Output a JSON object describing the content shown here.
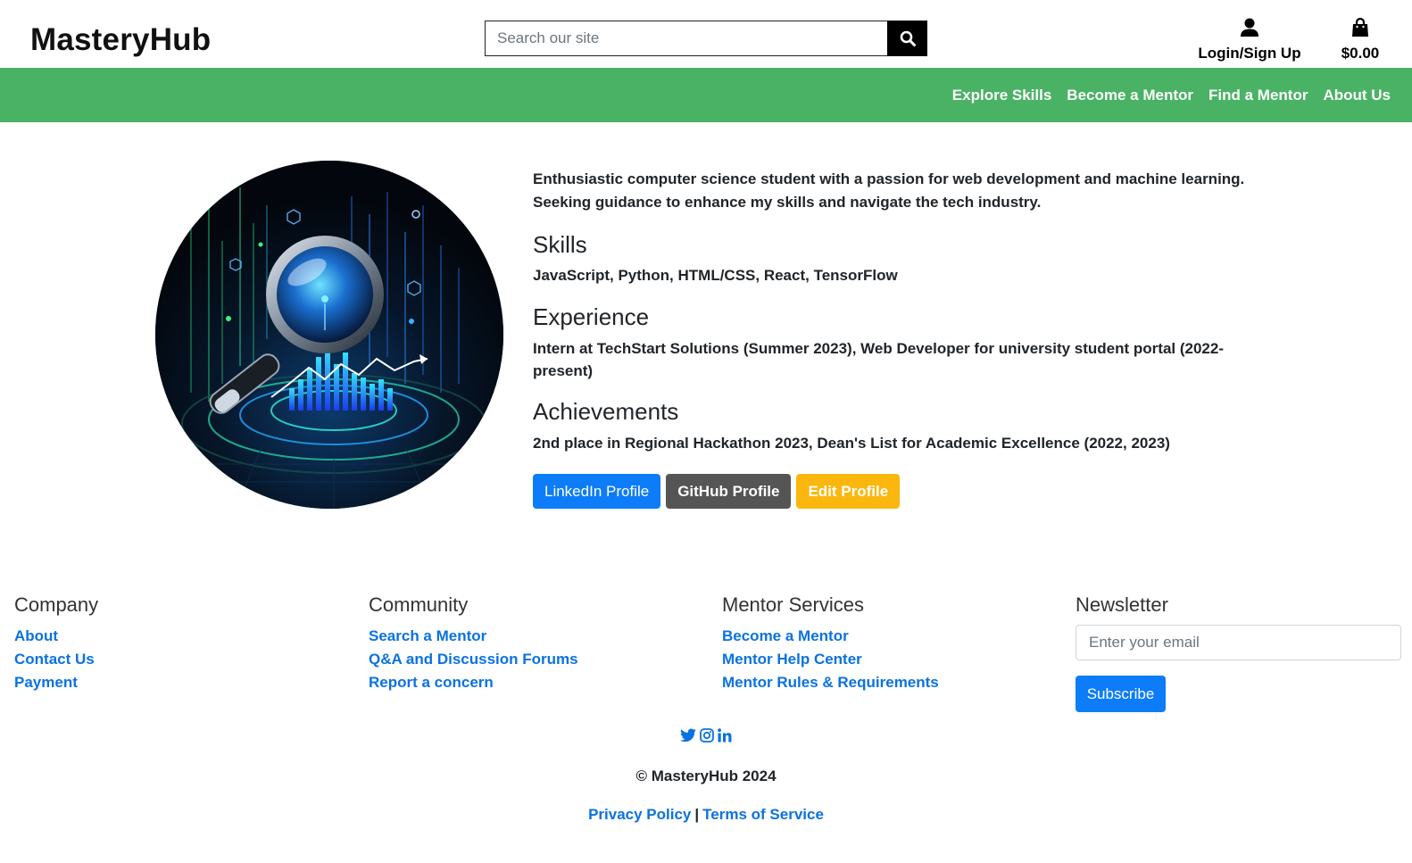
{
  "header": {
    "logo": "MasteryHub",
    "search_placeholder": "Search our site",
    "login_label": "Login/Sign Up",
    "cart_total": "$0.00"
  },
  "nav": {
    "items": [
      "Explore Skills",
      "Become a Mentor",
      "Find a Mentor",
      "About Us"
    ]
  },
  "profile": {
    "bio": "Enthusiastic computer science student with a passion for web development and machine learning. Seeking guidance to enhance my skills and navigate the tech industry.",
    "skills_heading": "Skills",
    "skills": "JavaScript, Python, HTML/CSS, React, TensorFlow",
    "experience_heading": "Experience",
    "experience": "Intern at TechStart Solutions (Summer 2023), Web Developer for university student portal (2022-present)",
    "achievements_heading": "Achievements",
    "achievements": "2nd place in Regional Hackathon 2023, Dean's List for Academic Excellence (2022, 2023)",
    "buttons": {
      "linkedin": "LinkedIn Profile",
      "github": "GitHub Profile",
      "edit": "Edit Profile"
    }
  },
  "footer": {
    "company": {
      "heading": "Company",
      "links": [
        "About",
        "Contact Us",
        "Payment"
      ]
    },
    "community": {
      "heading": "Community",
      "links": [
        "Search a Mentor",
        "Q&A and Discussion Forums",
        "Report a concern"
      ]
    },
    "mentor_services": {
      "heading": "Mentor Services",
      "links": [
        "Become a Mentor",
        "Mentor Help Center",
        "Mentor Rules & Requirements"
      ]
    },
    "newsletter": {
      "heading": "Newsletter",
      "placeholder": "Enter your email",
      "button": "Subscribe"
    },
    "social_icons": [
      "twitter-icon",
      "instagram-icon",
      "linkedin-icon"
    ],
    "copyright": "© MasteryHub 2024",
    "privacy": "Privacy Policy",
    "separator": "|",
    "terms": "Terms of Service"
  },
  "colors": {
    "nav_green": "#4ab264",
    "link_blue": "#0a72e0",
    "primary_blue": "#0d7cf8",
    "github_gray": "#555555",
    "edit_yellow": "#fbb70d"
  }
}
